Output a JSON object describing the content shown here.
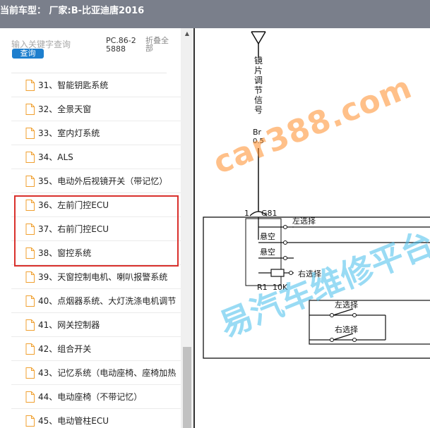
{
  "title": "当前车型：  厂家:B-比亚迪唐2016",
  "search": {
    "placeholder": "输入关键字查询",
    "button_label": "查询",
    "pc_code": "PC.86-25888",
    "collapse_label": "折叠全部"
  },
  "tree_items": [
    {
      "label": "31、智能钥匙系统"
    },
    {
      "label": "32、全景天窗"
    },
    {
      "label": "33、室内灯系统"
    },
    {
      "label": "34、ALS"
    },
    {
      "label": "35、电动外后视镜开关（带记忆）"
    },
    {
      "label": "36、左前门控ECU"
    },
    {
      "label": "37、右前门控ECU"
    },
    {
      "label": "38、窗控系统"
    },
    {
      "label": "39、天窗控制电机、喇叭报警系统"
    },
    {
      "label": "40、点烟器系统、大灯洗涤电机调节"
    },
    {
      "label": "41、网关控制器"
    },
    {
      "label": "42、组合开关"
    },
    {
      "label": "43、记忆系统（电动座椅、座椅加热"
    },
    {
      "label": "44、电动座椅（不带记忆）"
    },
    {
      "label": "45、电动管柱ECU"
    }
  ],
  "highlight": {
    "color": "#d9302c"
  },
  "diagram": {
    "signal_label": [
      "镜",
      "片",
      "调",
      "节",
      "信",
      "号"
    ],
    "wire_label": "Br",
    "wire_size": "0.5",
    "connector_pin": "1",
    "connector_id": "G81",
    "switch_left": "左选择",
    "hanging_1": "悬空",
    "hanging_2": "悬空",
    "switch_right": "右选择",
    "resistor_id": "R1",
    "resistor_value": "10K",
    "lower_left": "左选择",
    "lower_right": "右选择"
  },
  "watermark": {
    "line1": "car388.com",
    "line2": "易汽车维修平台"
  },
  "colors": {
    "titlebar_bg": "#7a7f8b",
    "search_button": "#1e7fce",
    "file_icon": "#f0a030"
  }
}
